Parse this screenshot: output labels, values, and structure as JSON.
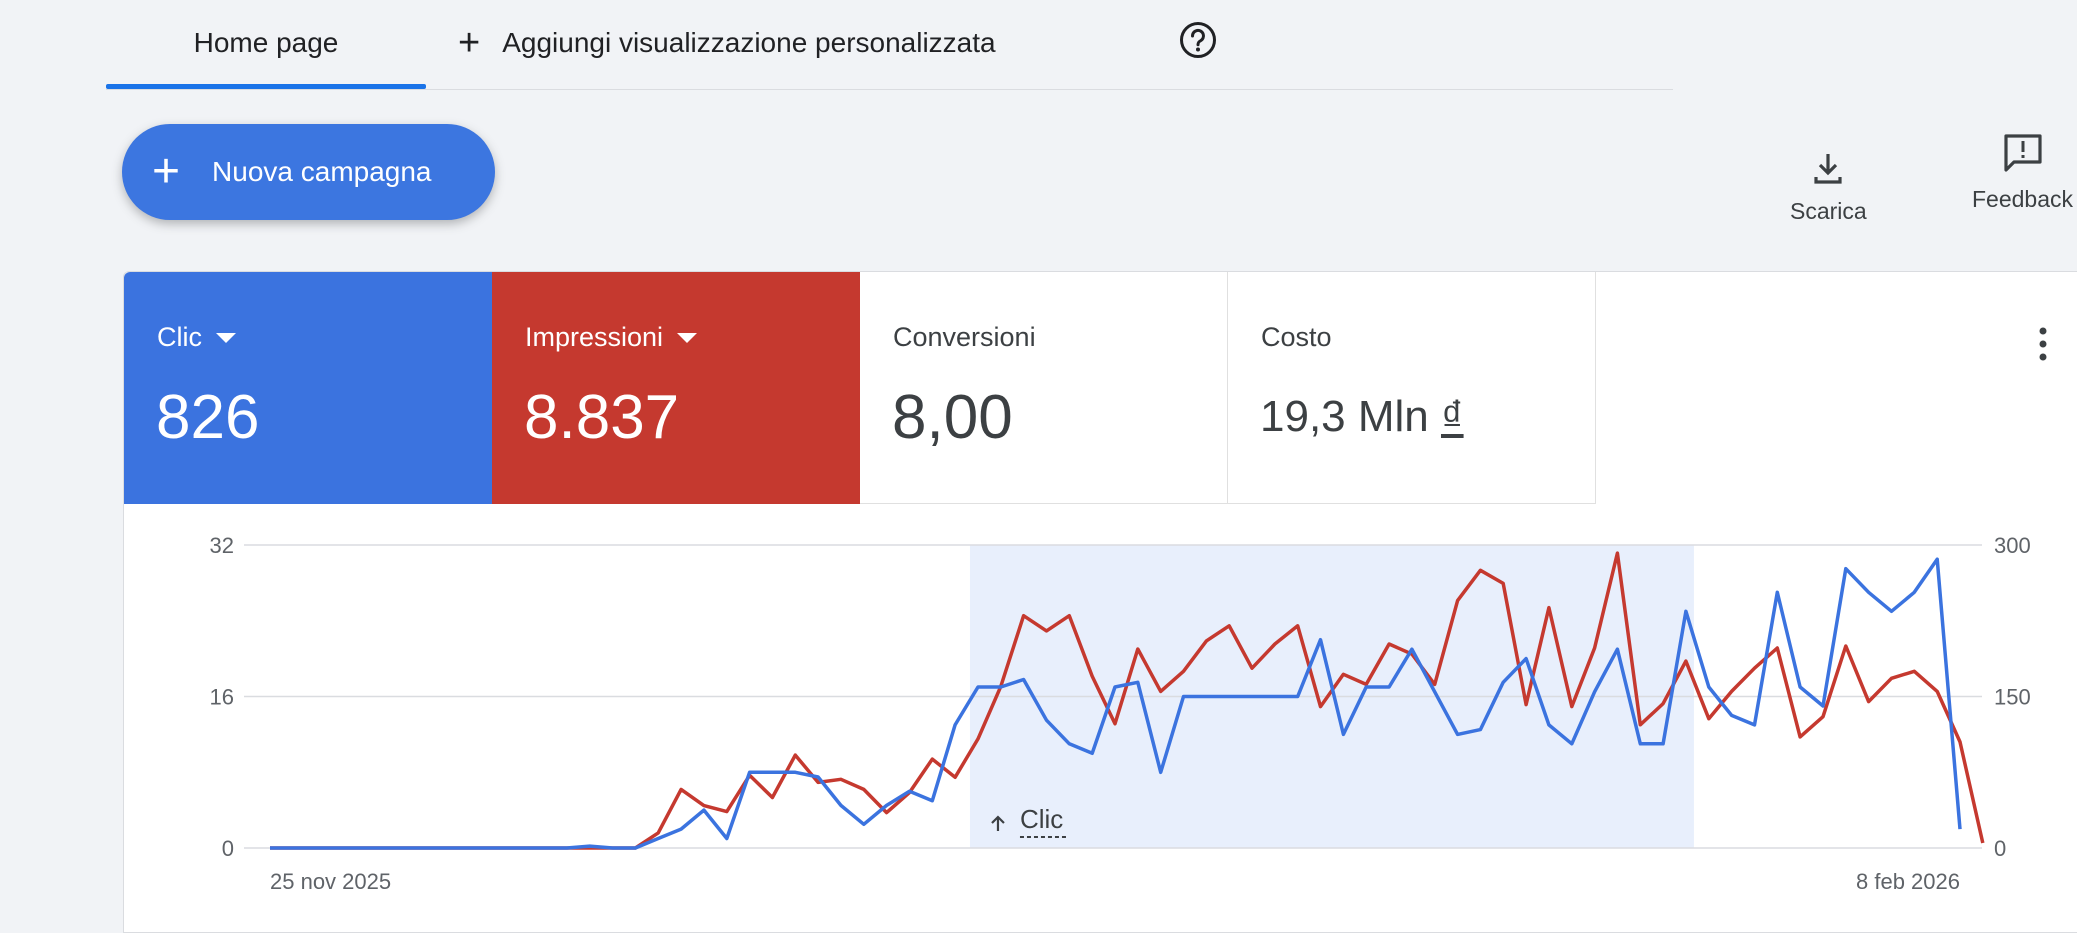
{
  "tabs": {
    "home": "Home page",
    "add_view": "Aggiungi visualizzazione personalizzata"
  },
  "new_campaign_label": "Nuova campagna",
  "tools": {
    "download": "Scarica",
    "feedback": "Feedback"
  },
  "metrics": {
    "clic": {
      "label": "Clic",
      "value": "826"
    },
    "impressioni": {
      "label": "Impressioni",
      "value": "8.837"
    },
    "conversioni": {
      "label": "Conversioni",
      "value": "8,00"
    },
    "costo": {
      "label": "Costo",
      "value": "19,3 Mln ",
      "currency": "₫"
    }
  },
  "colors": {
    "accent_blue": "#3b73df",
    "accent_red": "#c5392f",
    "highlight": "#e8effc"
  },
  "chart_data": {
    "type": "line",
    "x_start_label": "25 nov 2025",
    "x_end_label": "8 feb 2026",
    "annotation": "Clic",
    "highlight_range": [
      31,
      62
    ],
    "left_axis": {
      "ticks": [
        "0",
        "16",
        "32"
      ],
      "ylim": [
        0,
        32
      ]
    },
    "right_axis": {
      "ticks": [
        "0",
        "150",
        "300"
      ],
      "ylim": [
        0,
        300
      ]
    },
    "series": [
      {
        "name": "Clic",
        "axis": "left",
        "color": "#3b73df",
        "values": [
          0,
          0,
          0,
          0,
          0,
          0,
          0,
          0,
          0,
          0,
          0,
          0,
          0,
          0,
          0.2,
          0,
          0,
          1,
          2,
          4,
          1,
          8,
          8,
          8,
          7.5,
          4.5,
          2.5,
          4.5,
          6,
          5,
          13,
          17,
          17,
          17.8,
          13.5,
          11,
          10,
          17,
          17.5,
          8,
          16,
          16,
          16,
          16,
          16,
          16,
          22,
          12,
          17,
          17,
          21,
          16.5,
          12,
          12.5,
          17.5,
          20,
          13,
          11,
          16.5,
          21,
          11,
          11,
          25,
          17,
          14,
          13,
          27,
          17,
          15,
          29.5,
          27,
          25,
          27,
          30.5,
          2
        ]
      },
      {
        "name": "Impressioni",
        "axis": "right",
        "color": "#c5392f",
        "values": [
          0,
          0,
          0,
          0,
          0,
          0,
          0,
          0,
          0,
          0,
          0,
          0,
          0,
          0,
          0,
          0,
          0,
          15,
          58,
          42,
          36,
          72,
          50,
          92,
          65,
          68,
          58,
          35,
          55,
          88,
          70,
          108,
          160,
          230,
          215,
          230,
          170,
          123,
          197,
          155,
          175,
          205,
          220,
          178,
          202,
          220,
          140,
          172,
          162,
          202,
          192,
          162,
          245,
          275,
          262,
          142,
          238,
          140,
          198,
          292,
          122,
          143,
          185,
          128,
          155,
          178,
          198,
          110,
          130,
          200,
          145,
          168,
          175,
          155,
          105,
          5
        ]
      }
    ]
  }
}
